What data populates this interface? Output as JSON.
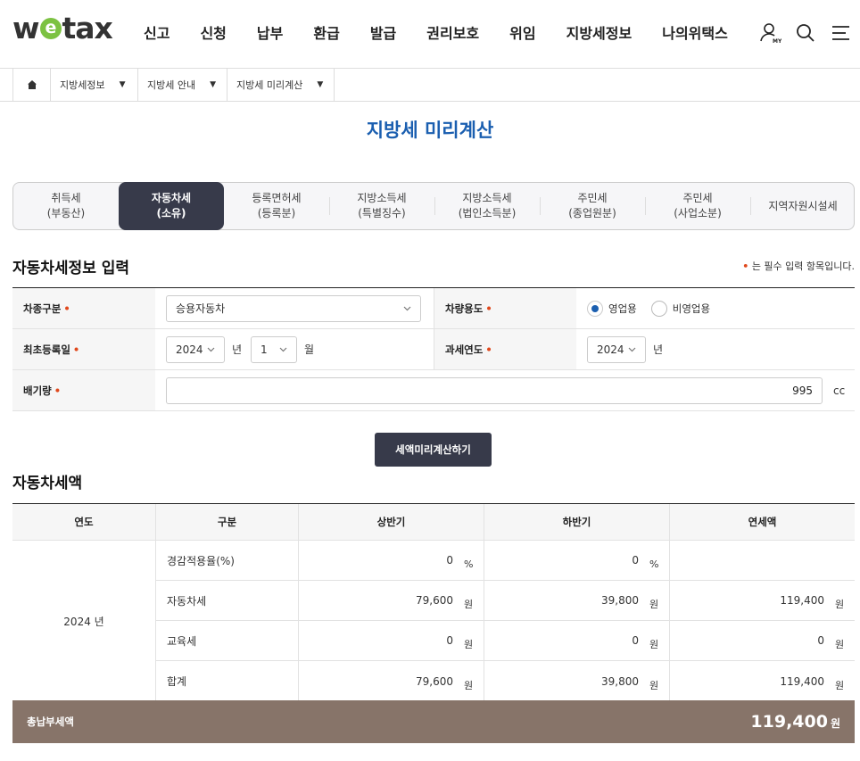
{
  "header": {
    "logo": "wetax",
    "nav": [
      "신고",
      "신청",
      "납부",
      "환급",
      "발급",
      "권리보호",
      "위임",
      "지방세정보",
      "나의위택스"
    ],
    "my_badge": "MY",
    "icons": [
      "user-my-icon",
      "search-icon",
      "menu-icon"
    ]
  },
  "breadcrumb": [
    "지방세정보",
    "지방세 안내",
    "지방세 미리계산"
  ],
  "page_title": "지방세 미리계산",
  "tabs": [
    {
      "line1": "취득세",
      "line2": "(부동산)"
    },
    {
      "line1": "자동차세",
      "line2": "(소유)"
    },
    {
      "line1": "등록면허세",
      "line2": "(등록분)"
    },
    {
      "line1": "지방소득세",
      "line2": "(특별징수)"
    },
    {
      "line1": "지방소득세",
      "line2": "(법인소득분)"
    },
    {
      "line1": "주민세",
      "line2": "(종업원분)"
    },
    {
      "line1": "주민세",
      "line2": "(사업소분)"
    },
    {
      "line1": "지역자원시설세",
      "line2": ""
    }
  ],
  "form_section": {
    "title": "자동차세정보 입력",
    "required_note": "는 필수 입력 항목입니다.",
    "vehicle_type_label": "차종구분",
    "vehicle_type_value": "승용자동차",
    "vehicle_use_label": "차량용도",
    "use_options": [
      "영업용",
      "비영업용"
    ],
    "first_reg_label": "최초등록일",
    "reg_year": "2024",
    "year_unit": "년",
    "reg_month": "1",
    "month_unit": "월",
    "tax_year_label": "과세연도",
    "tax_year": "2024",
    "displacement_label": "배기량",
    "displacement_value": "995",
    "displacement_unit": "cc"
  },
  "calc_button": "세액미리계산하기",
  "result": {
    "title": "자동차세액",
    "headers": [
      "연도",
      "구분",
      "상반기",
      "하반기",
      "연세액"
    ],
    "year": "2024 년",
    "rows": [
      {
        "name": "경감적용율(%)",
        "first": "0",
        "first_unit": "%",
        "second": "0",
        "second_unit": "%",
        "annual": "",
        "annual_unit": ""
      },
      {
        "name": "자동차세",
        "first": "79,600",
        "first_unit": "원",
        "second": "39,800",
        "second_unit": "원",
        "annual": "119,400",
        "annual_unit": "원"
      },
      {
        "name": "교육세",
        "first": "0",
        "first_unit": "원",
        "second": "0",
        "second_unit": "원",
        "annual": "0",
        "annual_unit": "원"
      },
      {
        "name": "합계",
        "first": "79,600",
        "first_unit": "원",
        "second": "39,800",
        "second_unit": "원",
        "annual": "119,400",
        "annual_unit": "원"
      }
    ],
    "total_label": "총납부세액",
    "total_value": "119,400",
    "total_unit": "원"
  }
}
